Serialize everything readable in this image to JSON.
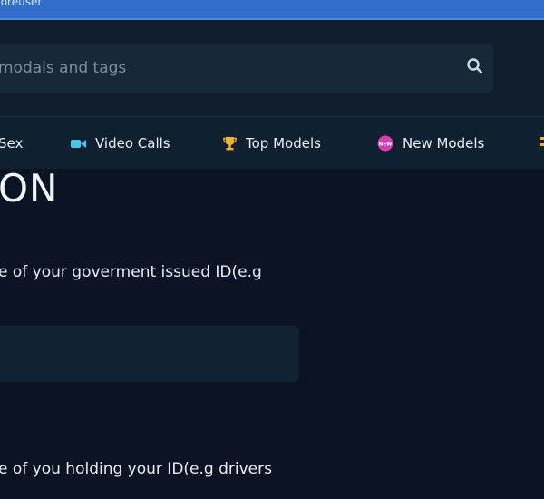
{
  "window": {
    "title": "toreuser"
  },
  "search": {
    "placeholder": "modals and tags"
  },
  "nav": {
    "items": [
      {
        "label": "Sex"
      },
      {
        "label": "Video Calls"
      },
      {
        "label": "Top Models"
      },
      {
        "label": "New Models"
      }
    ],
    "new_badge": "NEW"
  },
  "page": {
    "title": "ON",
    "field1_label": "e of your goverment issued ID(e.g",
    "field2_label": "e of you holding your ID(e.g drivers"
  },
  "colors": {
    "background": "#0a1422",
    "header": "#0f1d2d",
    "titlebar": "#2f6fc9",
    "video_icon": "#49c6e6",
    "trophy_icon": "#f0b429",
    "new_badge": "#d63fb3"
  }
}
